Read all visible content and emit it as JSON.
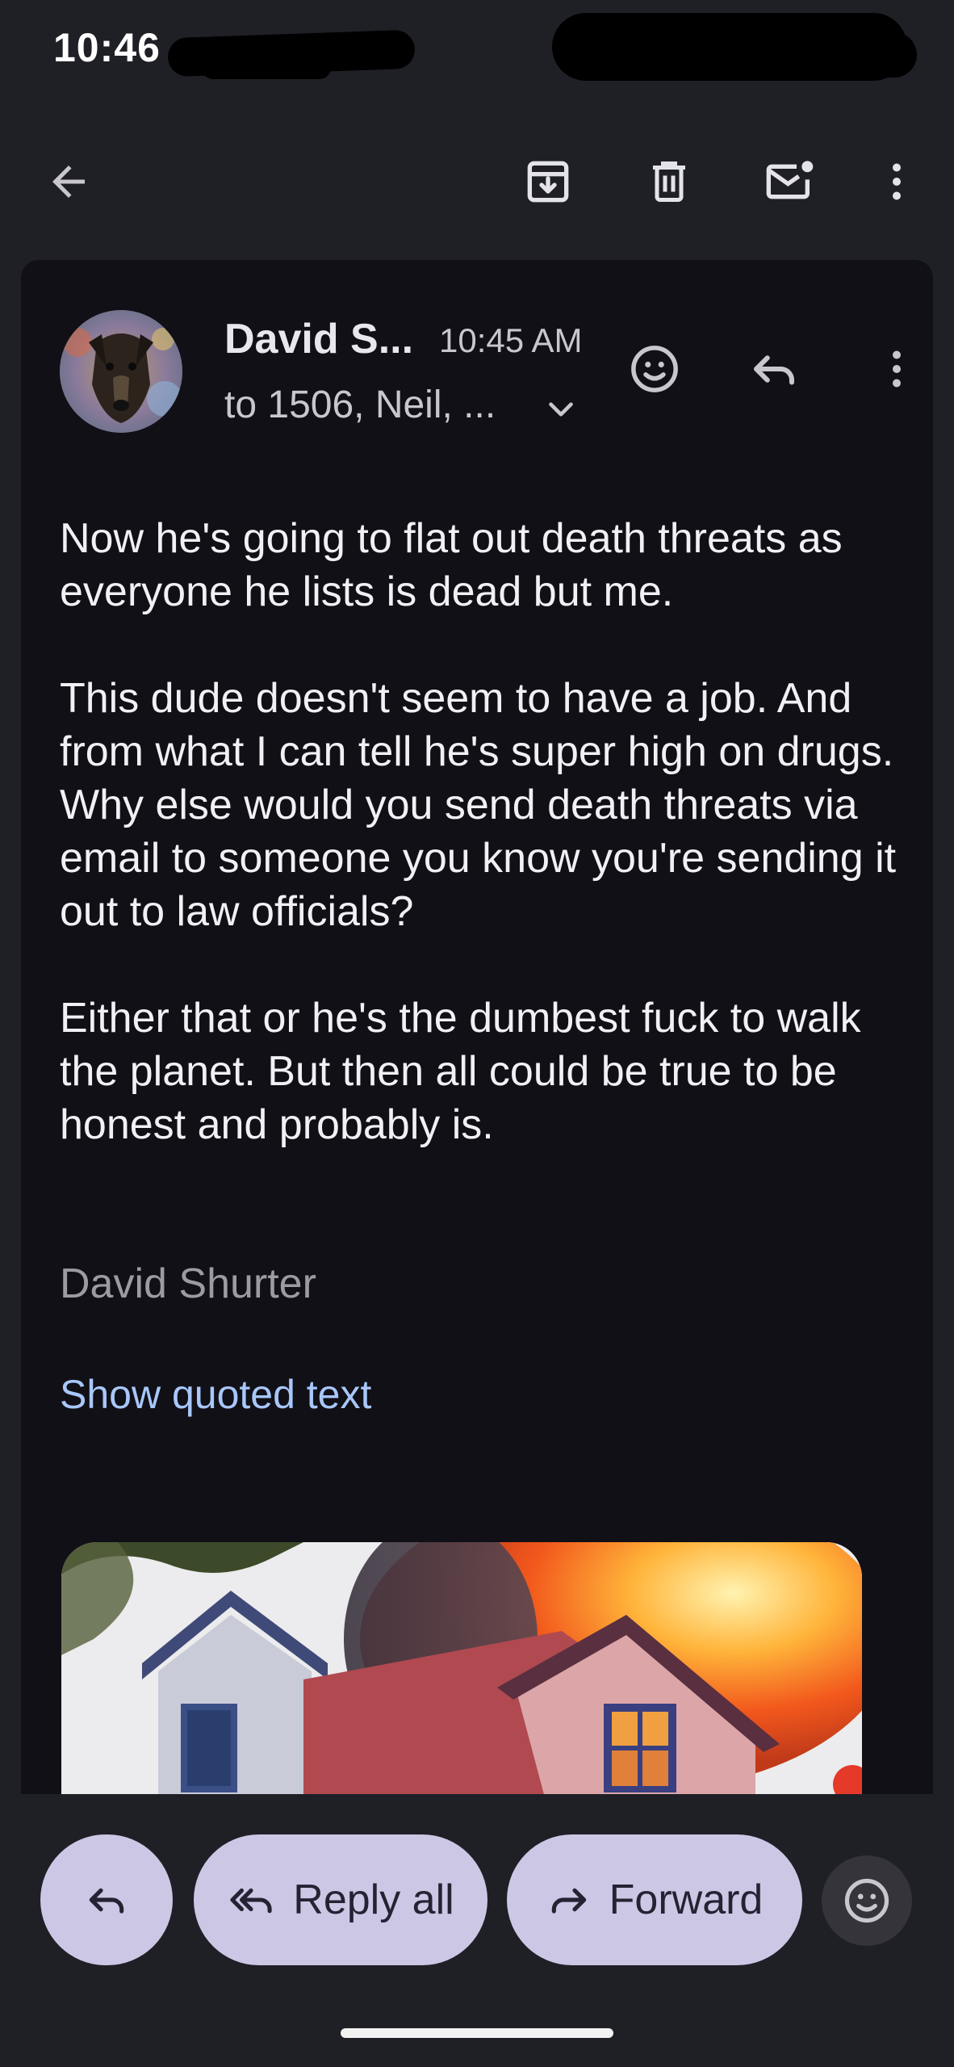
{
  "status_bar": {
    "time": "10:46"
  },
  "toolbar": {
    "back_icon": "arrow-back-icon",
    "archive_icon": "archive-icon",
    "delete_icon": "trash-icon",
    "mark_unread_icon": "mail-unread-icon",
    "more_icon": "more-vert-icon"
  },
  "message": {
    "sender": "David S...",
    "time": "10:45 AM",
    "recipients": "to 1506, Neil, ...",
    "body": [
      "Now he's going to flat out death threats as everyone he lists is dead but me.",
      "This dude doesn't seem to have a job. And from what I can tell he's super high on drugs. Why else would you send death threats via email to someone you know you're sending it out to law officials?",
      "Either that or he's the dumbest fuck to walk the planet. But then all could be true to be honest and probably is."
    ],
    "signature": "David Shurter",
    "show_quoted_text": "Show quoted text"
  },
  "actions": {
    "reply_all": "Reply all",
    "forward": "Forward"
  },
  "colors": {
    "background": "#1f1f26",
    "card": "#111016",
    "pill": "#cdc7e6",
    "link": "#a8c7fa"
  }
}
